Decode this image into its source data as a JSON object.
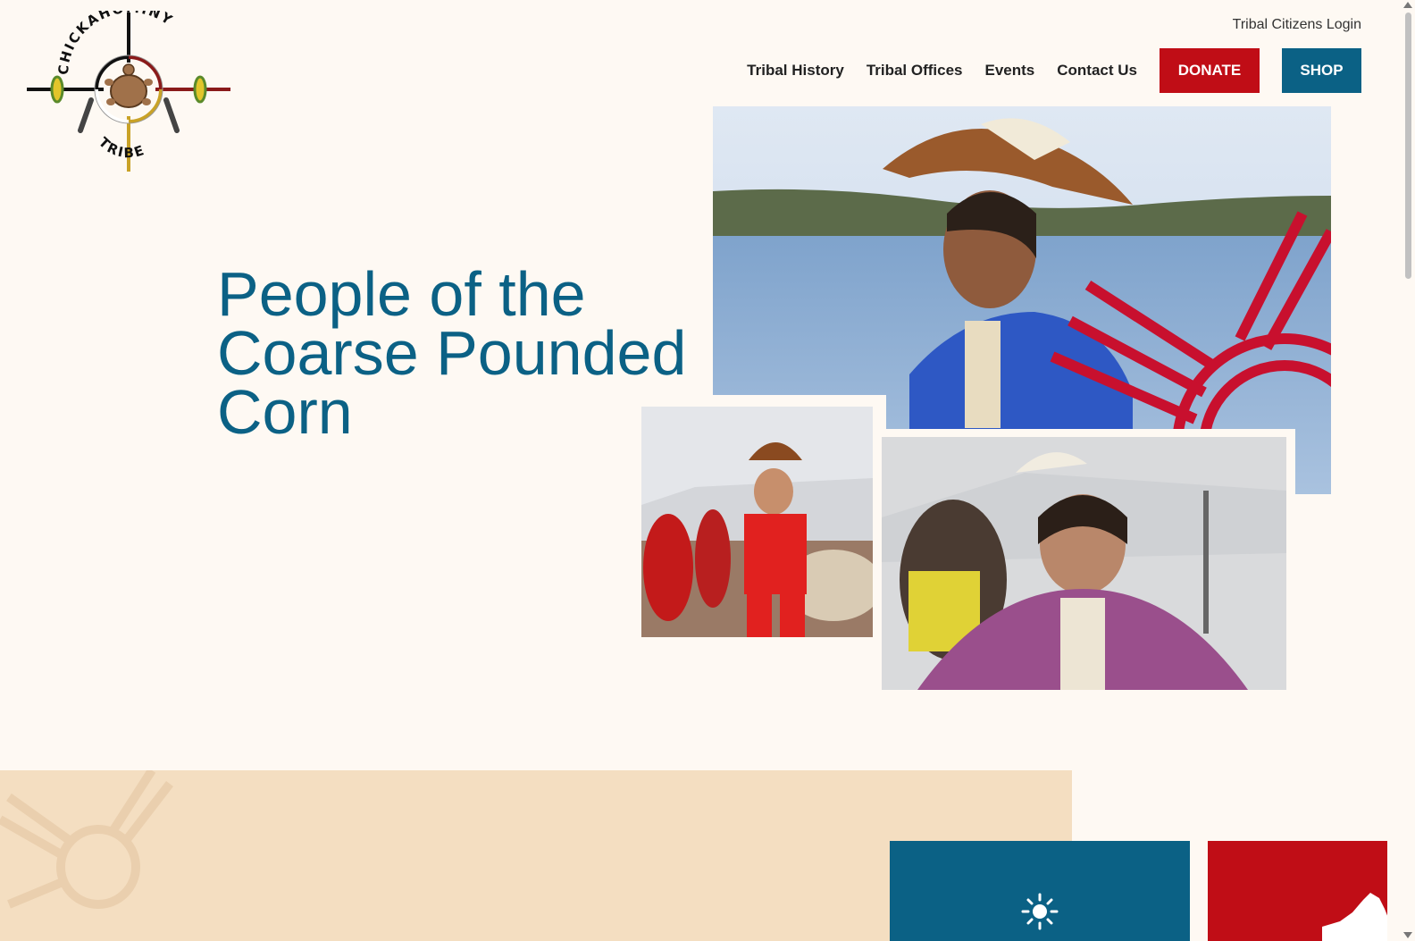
{
  "header": {
    "logo_text_top": "CHICKAHOMINY",
    "logo_text_bottom": "TRIBE",
    "login_label": "Tribal Citizens Login"
  },
  "nav": {
    "items": [
      {
        "label": "Tribal History"
      },
      {
        "label": "Tribal Offices"
      },
      {
        "label": "Events"
      },
      {
        "label": "Contact Us"
      }
    ],
    "donate_label": "DONATE",
    "shop_label": "SHOP"
  },
  "hero": {
    "title": "People of the Coarse Pounded Corn"
  },
  "colors": {
    "brand_blue": "#0b6185",
    "brand_red": "#c00d16",
    "page_background": "#fef9f3",
    "beige_band": "#f4dec1"
  },
  "icons": {
    "blue_card": "sun-icon",
    "red_card": "virginia-map-icon"
  }
}
